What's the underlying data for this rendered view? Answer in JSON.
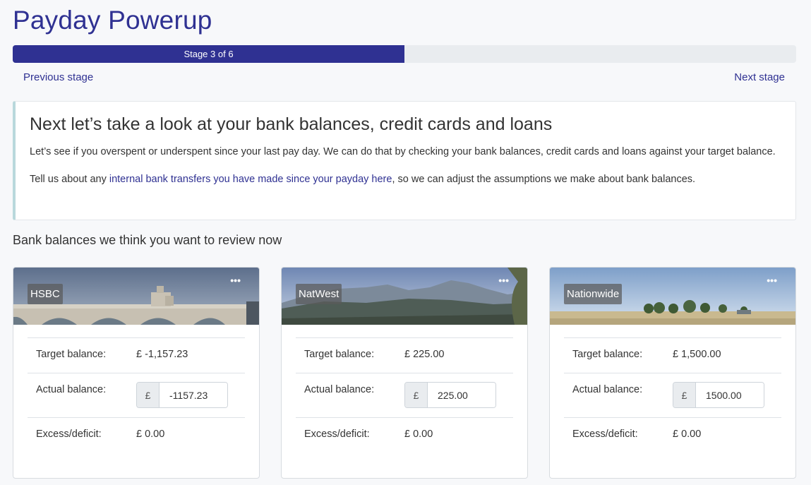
{
  "app": {
    "title": "Payday Powerup"
  },
  "progress": {
    "label": "Stage 3 of 6",
    "fraction": 0.5
  },
  "nav": {
    "previous": "Previous stage",
    "next": "Next stage"
  },
  "intro": {
    "heading": "Next let’s take a look at your bank balances, credit cards and loans",
    "para1": "Let’s see if you overspent or underspent since your last pay day. We can do that by checking your bank balances, credit cards and loans against your target balance.",
    "para2_before": "Tell us about any ",
    "para2_link": "internal bank transfers you have made since your payday here",
    "para2_after": ", so we can adjust the assumptions we make about bank balances."
  },
  "section": {
    "heading": "Bank balances we think you want to review now"
  },
  "labels": {
    "target": "Target balance:",
    "actual": "Actual balance:",
    "excess": "Excess/deficit:",
    "currency": "£"
  },
  "cards": [
    {
      "bank": "HSBC",
      "target": "£ -1,157.23",
      "actual": "-1157.23",
      "excess": "£ 0.00",
      "image": "bridge"
    },
    {
      "bank": "NatWest",
      "target": "£ 225.00",
      "actual": "225.00",
      "excess": "£ 0.00",
      "image": "mountains"
    },
    {
      "bank": "Nationwide",
      "target": "£ 1,500.00",
      "actual": "1500.00",
      "excess": "£ 0.00",
      "image": "field"
    }
  ],
  "icons": {
    "more": "more-horizontal-icon"
  },
  "colors": {
    "brand": "#2f3192",
    "accent_border": "#b9d8dc"
  }
}
